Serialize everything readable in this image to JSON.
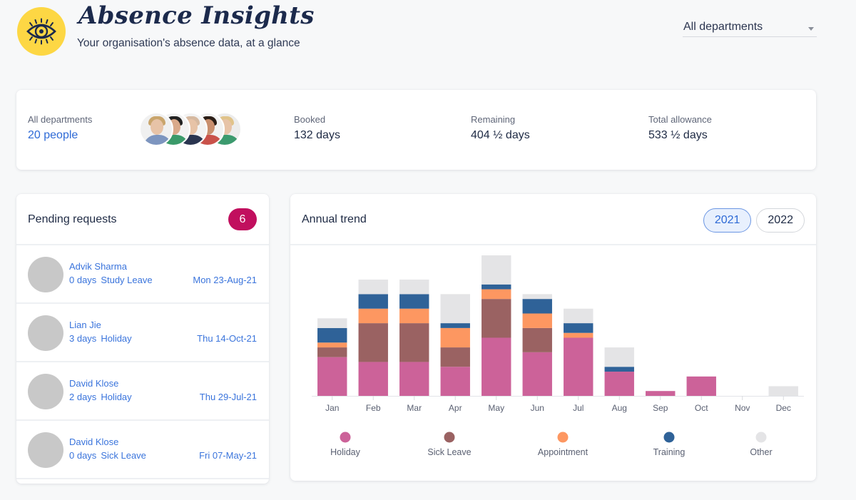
{
  "header": {
    "title": "Absence Insights",
    "subtitle": "Your organisation's absence data, at a glance",
    "logo_icon": "eye-icon",
    "department_select": {
      "value": "All departments"
    }
  },
  "summary": {
    "department_label": "All departments",
    "people": "20 people",
    "avatar_count": 5,
    "stats": [
      {
        "label": "Booked",
        "value": "132 days"
      },
      {
        "label": "Remaining",
        "value": "404 ½ days"
      },
      {
        "label": "Total allowance",
        "value": "533 ½ days"
      }
    ]
  },
  "pending": {
    "title": "Pending requests",
    "count": "6",
    "requests": [
      {
        "name": "Advik Sharma",
        "days": "0 days",
        "type": "Study Leave",
        "date": "Mon 23-Aug-21"
      },
      {
        "name": "Lian Jie",
        "days": "3 days",
        "type": "Holiday",
        "date": "Thu 14-Oct-21"
      },
      {
        "name": "David Klose",
        "days": "2 days",
        "type": "Holiday",
        "date": "Thu 29-Jul-21"
      },
      {
        "name": "David Klose",
        "days": "0 days",
        "type": "Sick Leave",
        "date": "Fri 07-May-21"
      }
    ]
  },
  "trend": {
    "title": "Annual trend",
    "years": [
      {
        "label": "2021",
        "active": true
      },
      {
        "label": "2022",
        "active": false
      }
    ]
  },
  "colors": {
    "accent": "#2e6ad6",
    "badge": "#c10f5e",
    "logo": "#fdd744"
  },
  "chart_data": {
    "type": "bar",
    "stacked": true,
    "title": "Annual trend",
    "xlabel": "",
    "ylabel": "",
    "categories": [
      "Jan",
      "Feb",
      "Mar",
      "Apr",
      "May",
      "Jun",
      "Jul",
      "Aug",
      "Sep",
      "Oct",
      "Nov",
      "Dec"
    ],
    "series": [
      {
        "name": "Holiday",
        "color": "#cc6299",
        "values": [
          8,
          7,
          7,
          6,
          12,
          9,
          12,
          5,
          1,
          4,
          0,
          0
        ]
      },
      {
        "name": "Sick Leave",
        "color": "#9a6262",
        "values": [
          2,
          8,
          8,
          4,
          8,
          5,
          0,
          0,
          0,
          0,
          0,
          0
        ]
      },
      {
        "name": "Appointment",
        "color": "#fd9761",
        "values": [
          1,
          3,
          3,
          4,
          2,
          3,
          1,
          0,
          0,
          0,
          0,
          0
        ]
      },
      {
        "name": "Training",
        "color": "#2f6298",
        "values": [
          3,
          3,
          3,
          1,
          1,
          3,
          2,
          1,
          0,
          0,
          0,
          0
        ]
      },
      {
        "name": "Other",
        "color": "#e4e4e6",
        "values": [
          2,
          3,
          3,
          6,
          6,
          1,
          3,
          4,
          0,
          0,
          0,
          2
        ]
      }
    ],
    "ylim": [
      0,
      29
    ],
    "grid": false,
    "legend": "bottom"
  }
}
